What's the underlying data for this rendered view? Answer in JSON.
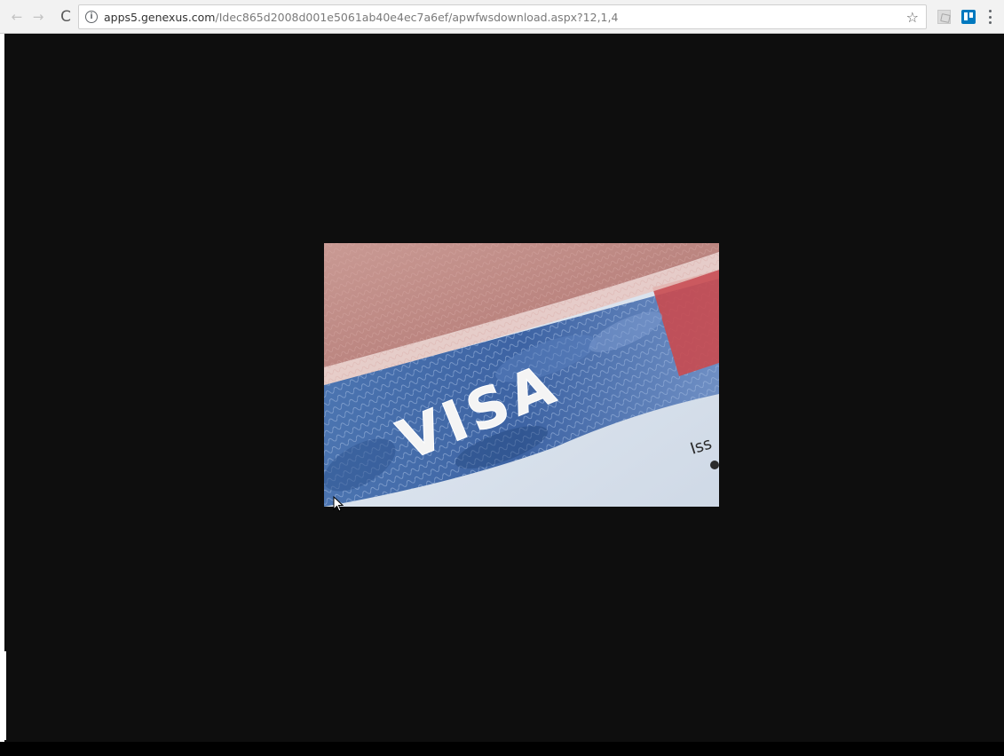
{
  "browser": {
    "url_domain": "apps5.genexus.com",
    "url_path": "/Idec865d2008d001e5061ab40e4ec7a6ef/apwfwsdownload.aspx?12,1,4",
    "icons": {
      "back": "back-arrow-icon",
      "forward": "forward-arrow-icon",
      "reload": "reload-icon",
      "info": "info-icon",
      "bookmark": "star-icon",
      "extension1": "pdf-extension-icon",
      "extension2": "trello-extension-icon",
      "menu": "kebab-menu-icon"
    }
  },
  "image": {
    "text_visa": "VISA",
    "text_issued": "Iss",
    "description_colors": {
      "page_background": "#0e0e0e",
      "visa_blue": "#3d63a3",
      "passport_red": "#b85a5a"
    }
  }
}
